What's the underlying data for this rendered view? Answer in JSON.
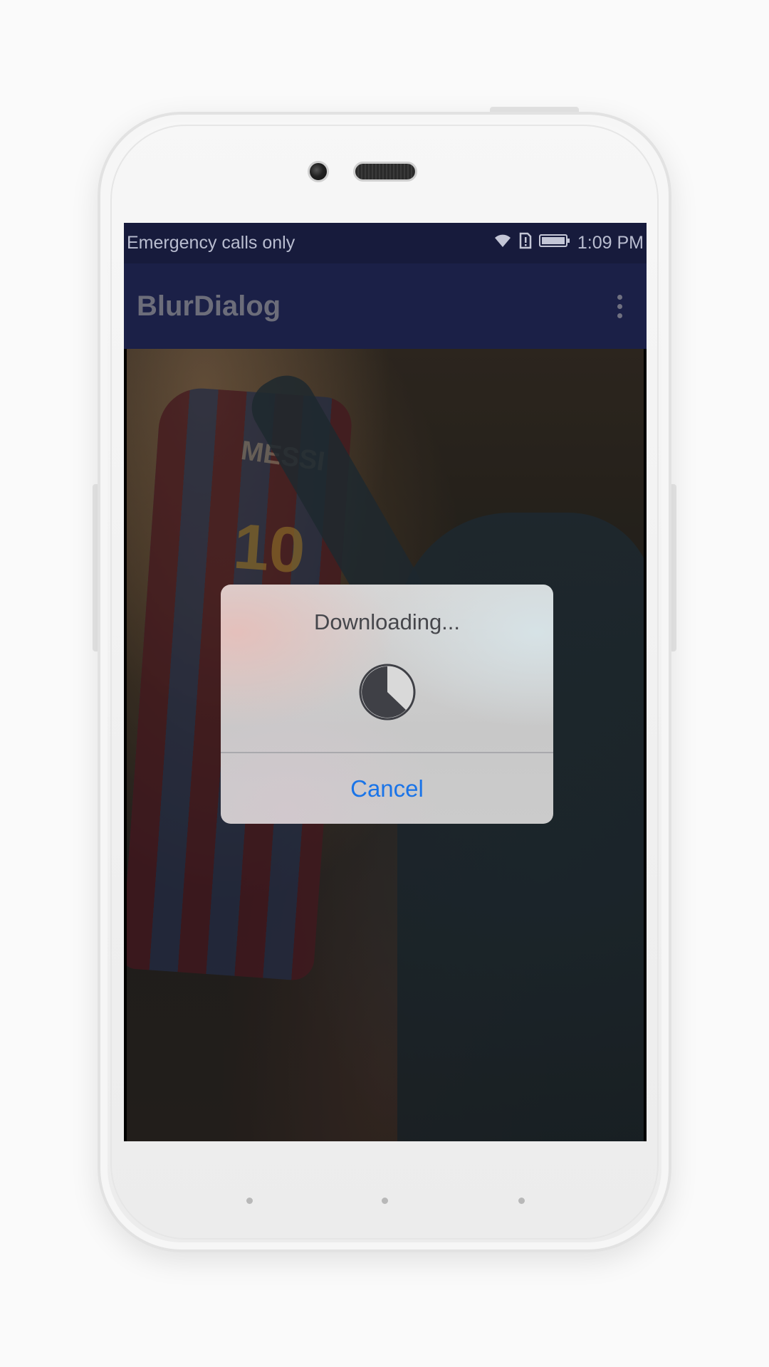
{
  "device": {
    "status_bar": {
      "carrier_text": "Emergency calls only",
      "time": "1:09 PM",
      "icons": [
        "wifi-icon",
        "sim-alert-icon",
        "battery-icon"
      ]
    },
    "nav_buttons": [
      "nav-dot-back",
      "nav-dot-home",
      "nav-dot-recents"
    ]
  },
  "app": {
    "title": "BlurDialog",
    "menu_icon": "overflow-menu-icon",
    "background_image": {
      "shirt_name": "MESSI",
      "shirt_number": "10"
    }
  },
  "dialog": {
    "title": "Downloading...",
    "spinner_icon": "progress-pie-icon",
    "cancel_label": "Cancel"
  },
  "colors": {
    "status_bar": "#171b3c",
    "app_bar": "#1b2047",
    "dialog_button": "#1a74e8"
  }
}
